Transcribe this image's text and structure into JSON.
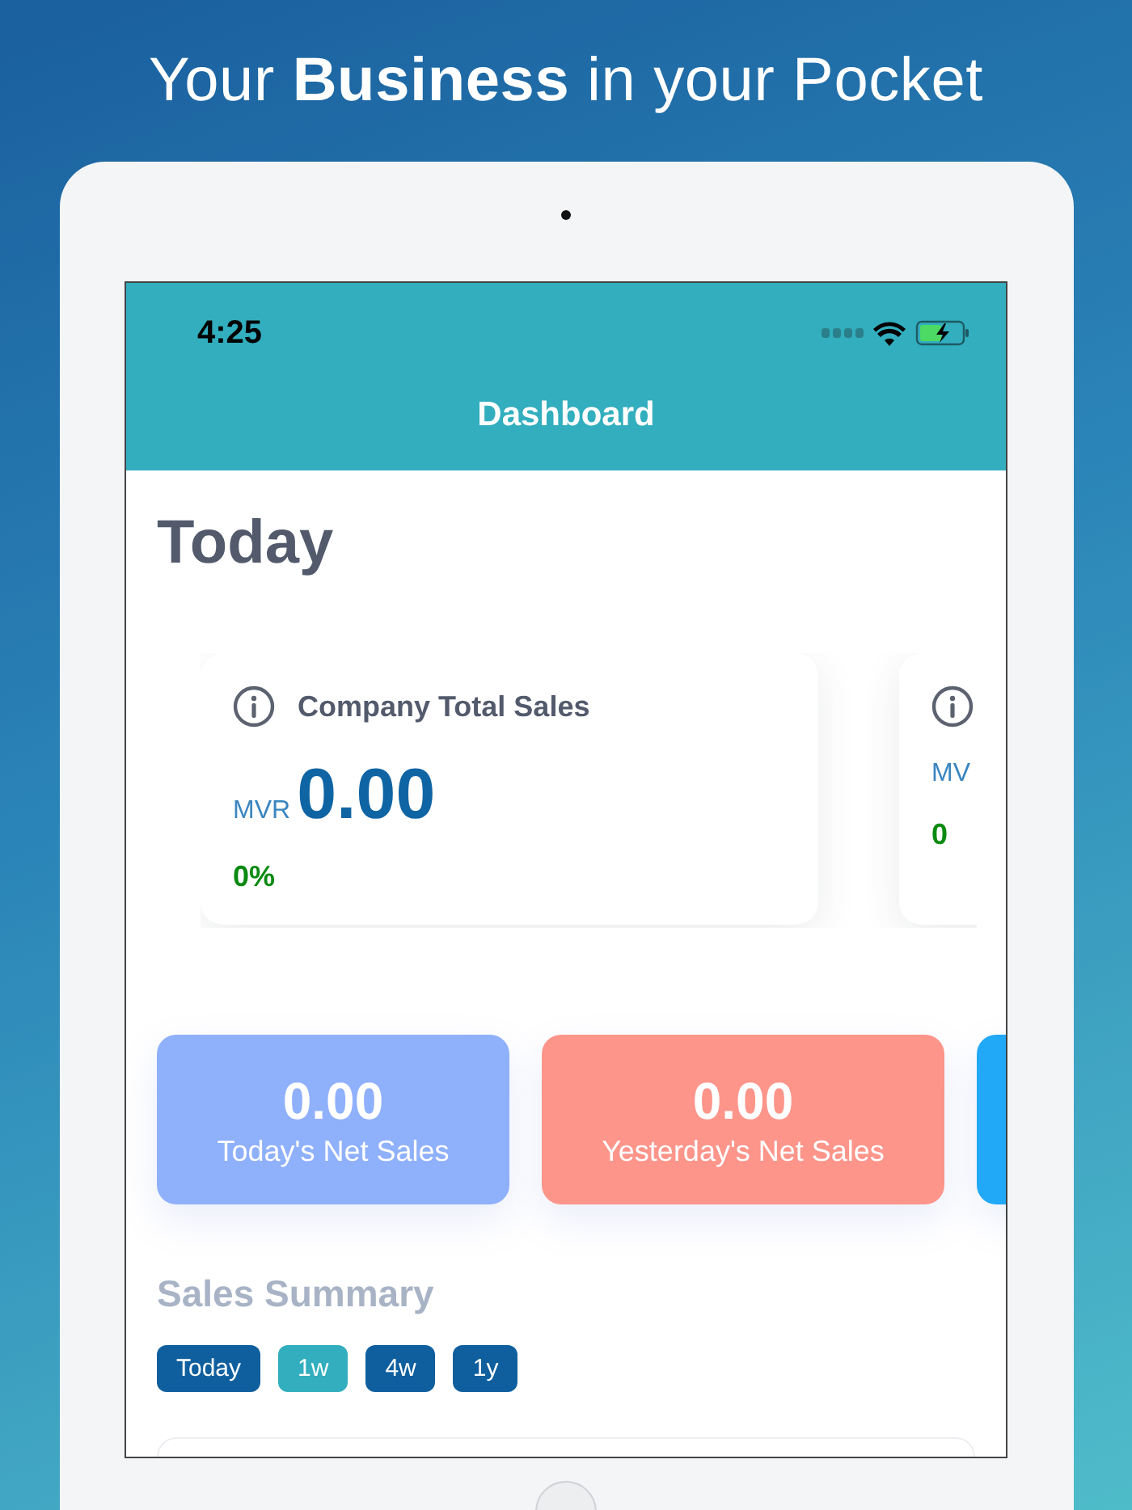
{
  "headline": "Your **Business** in your Pocket",
  "status_bar": {
    "time": "4:25"
  },
  "nav": {
    "title": "Dashboard"
  },
  "section_title": "Today",
  "summary_cards": [
    {
      "title": "Company Total Sales",
      "currency": "MVR",
      "amount": "0.00",
      "change": "0%"
    },
    {
      "currency": "MV",
      "change": "0"
    }
  ],
  "stat_tiles": [
    {
      "value": "0.00",
      "label": "Today's Net Sales",
      "color": "#8fb0fb"
    },
    {
      "value": "0.00",
      "label": "Yesterday's Net Sales",
      "color": "#fd958a"
    },
    {
      "color": "#21a9f8"
    }
  ],
  "sales_summary": {
    "title": "Sales Summary",
    "periods": [
      {
        "label": "Today",
        "selected": false
      },
      {
        "label": "1w",
        "selected": true
      },
      {
        "label": "4w",
        "selected": false
      },
      {
        "label": "1y",
        "selected": false
      }
    ]
  }
}
